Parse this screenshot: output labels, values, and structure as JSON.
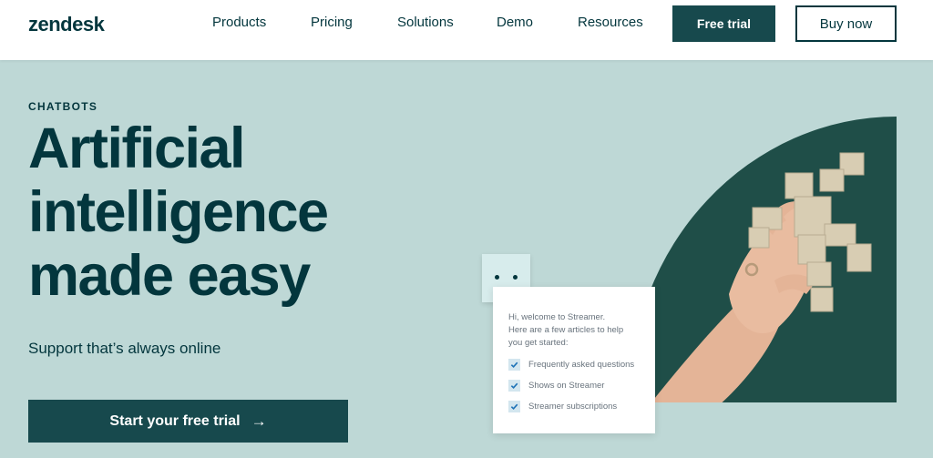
{
  "brand": {
    "logo_text": "zendesk"
  },
  "nav": {
    "items": [
      {
        "label": "Products"
      },
      {
        "label": "Pricing"
      },
      {
        "label": "Solutions"
      },
      {
        "label": "Demo"
      },
      {
        "label": "Resources"
      }
    ],
    "free_trial_label": "Free trial",
    "buy_now_label": "Buy now"
  },
  "hero": {
    "eyebrow": "CHATBOTS",
    "headline_lines": [
      "Artificial",
      "intelligence",
      "made easy"
    ],
    "subheading": "Support that’s always online",
    "cta_label": "Start your free trial",
    "cta_arrow": "→"
  },
  "chat_widget": {
    "greeting_lines": [
      "Hi, welcome to Streamer.",
      "Here are a few articles to help",
      "you get started:"
    ],
    "items": [
      {
        "label": "Frequently asked questions",
        "checked": true
      },
      {
        "label": "Shows on Streamer",
        "checked": true
      },
      {
        "label": "Streamer subscriptions",
        "checked": true
      }
    ]
  },
  "colors": {
    "brand_dark": "#03363d",
    "button_dark": "#17494d",
    "hero_bg": "#bed8d6",
    "art_dark_green": "#1f4e48"
  }
}
